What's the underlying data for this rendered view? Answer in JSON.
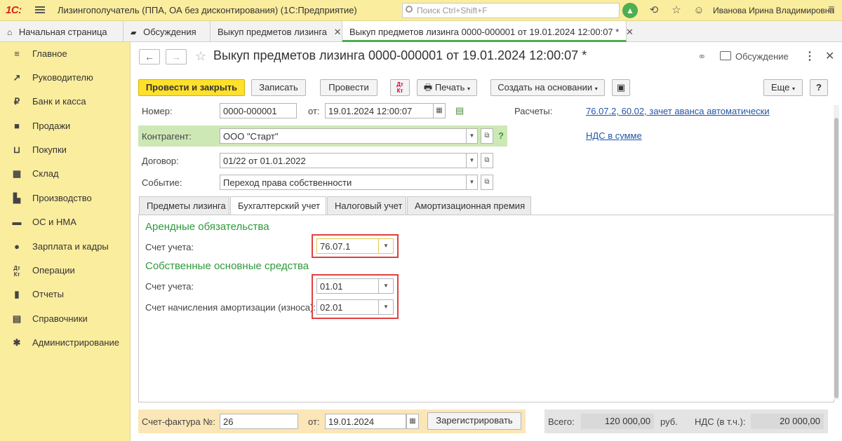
{
  "app": {
    "logo": "1С:",
    "title": "Лизингополучатель (ППА, ОА без дисконтирования)  (1С:Предприятие)",
    "search_placeholder": "Поиск Ctrl+Shift+F",
    "user": "Иванова Ирина Владимировна"
  },
  "tabs": [
    {
      "label": "Начальная страница",
      "icon": "home-icon"
    },
    {
      "label": "Обсуждения",
      "icon": "chat-icon"
    },
    {
      "label": "Выкуп предметов лизинга",
      "closable": true
    },
    {
      "label": "Выкуп предметов лизинга 0000-000001 от 19.01.2024 12:00:07 *",
      "closable": true,
      "active": true
    }
  ],
  "sidebar": {
    "items": [
      {
        "label": "Главное",
        "icon": "menu-lines-icon"
      },
      {
        "label": "Руководителю",
        "icon": "trend-icon"
      },
      {
        "label": "Банк и касса",
        "icon": "ruble-icon"
      },
      {
        "label": "Продажи",
        "icon": "bag-icon"
      },
      {
        "label": "Покупки",
        "icon": "cart-icon"
      },
      {
        "label": "Склад",
        "icon": "warehouse-icon"
      },
      {
        "label": "Производство",
        "icon": "factory-icon"
      },
      {
        "label": "ОС и НМА",
        "icon": "truck-icon"
      },
      {
        "label": "Зарплата и кадры",
        "icon": "person-icon"
      },
      {
        "label": "Операции",
        "icon": "dt-kt-icon"
      },
      {
        "label": "Отчеты",
        "icon": "bar-chart-icon"
      },
      {
        "label": "Справочники",
        "icon": "book-icon"
      },
      {
        "label": "Администрирование",
        "icon": "gear-icon"
      }
    ]
  },
  "header": {
    "title": "Выкуп предметов лизинга 0000-000001 от 19.01.2024 12:00:07 *",
    "discuss": "Обсуждение"
  },
  "toolbar": {
    "post_close": "Провести и закрыть",
    "save": "Записать",
    "post": "Провести",
    "dtkt_top": "Дт",
    "dtkt_bottom": "Кт",
    "print": "Печать",
    "create_based": "Создать на основании",
    "more": "Еще",
    "help": "?"
  },
  "form": {
    "number_label": "Номер:",
    "number": "0000-000001",
    "from_label": "от:",
    "date": "19.01.2024 12:00:07",
    "calc_label": "Расчеты:",
    "calc_link": "76.07.2, 60.02, зачет аванса автоматически",
    "vat_link": "НДС в сумме",
    "contractor_label": "Контрагент:",
    "contractor": "ООО \"Старт\"",
    "contract_label": "Договор:",
    "contract": "01/22 от 01.01.2022",
    "event_label": "Событие:",
    "event": "Переход права собственности"
  },
  "form_tabs": [
    "Предметы лизинга",
    "Бухгалтерский учет",
    "Налоговый учет",
    "Амортизационная премия"
  ],
  "accounting": {
    "section1": "Арендные обязательства",
    "account_label": "Счет учета:",
    "account1": "76.07.1",
    "section2": "Собственные основные средства",
    "account2": "01.01",
    "depr_label": "Счет начисления амортизации (износа):",
    "account3": "02.01"
  },
  "footer": {
    "invoice_label": "Счет-фактура №:",
    "invoice_no": "26",
    "from_label": "от:",
    "invoice_date": "19.01.2024",
    "register": "Зарегистрировать",
    "total_label": "Всего:",
    "total": "120 000,00",
    "currency": "руб.",
    "vat_label": "НДС (в т.ч.):",
    "vat": "20 000,00"
  }
}
